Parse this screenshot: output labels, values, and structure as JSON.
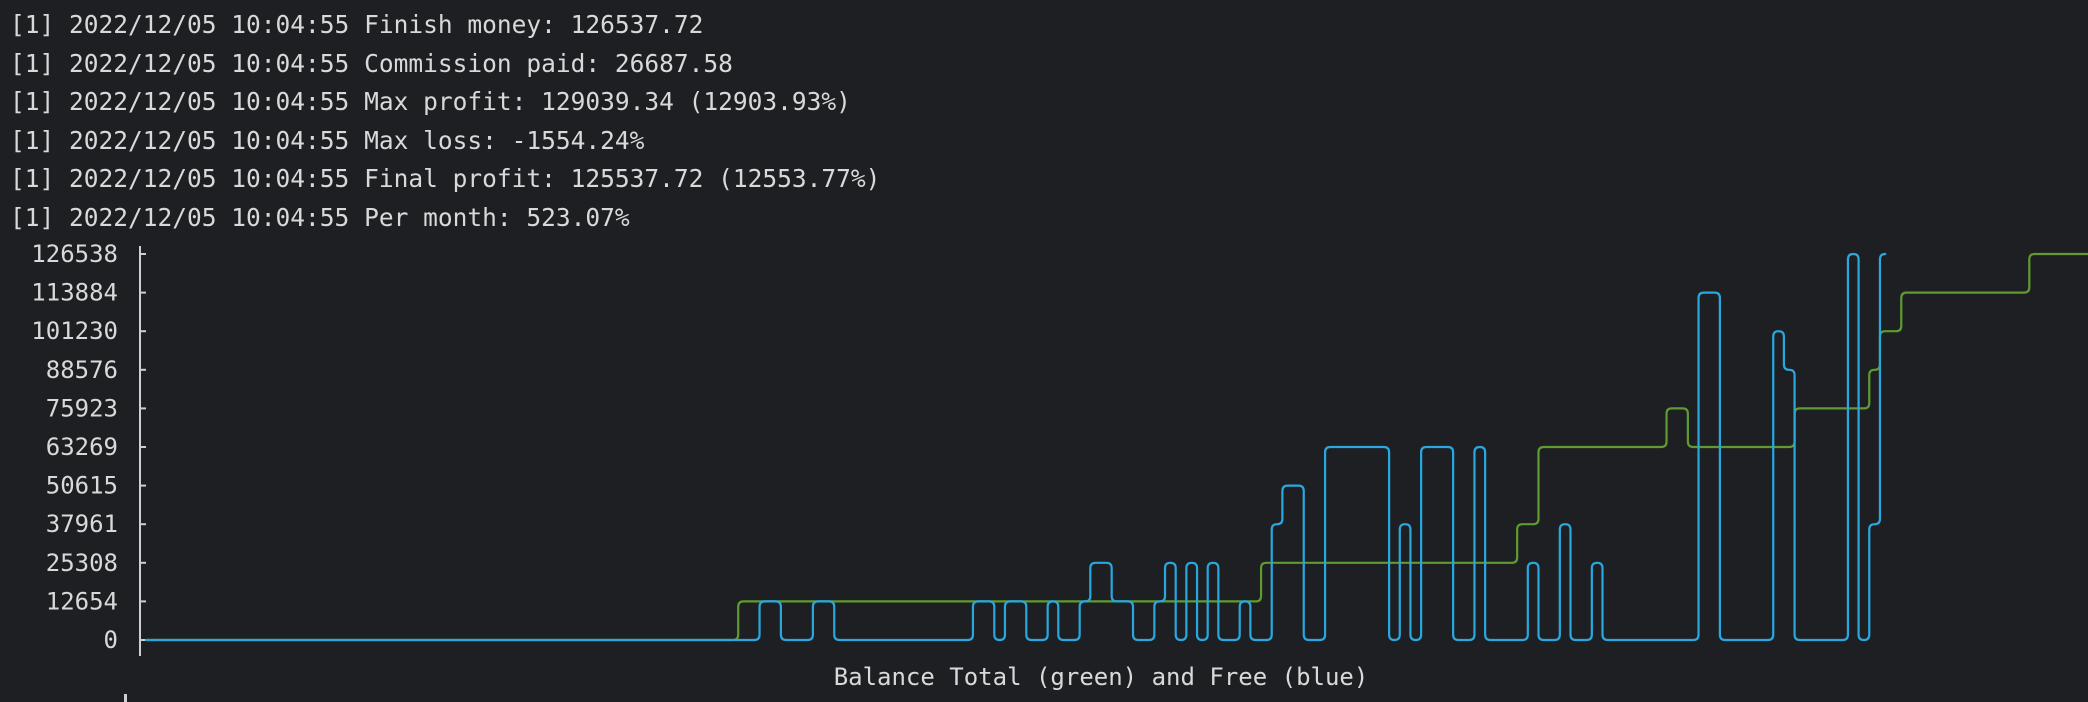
{
  "terminal": {
    "log_lines": [
      {
        "tag": "[1]",
        "timestamp": "2022/12/05 10:04:55",
        "message": "Finish money: 126537.72"
      },
      {
        "tag": "[1]",
        "timestamp": "2022/12/05 10:04:55",
        "message": "Commission paid: 26687.58"
      },
      {
        "tag": "[1]",
        "timestamp": "2022/12/05 10:04:55",
        "message": "Max profit: 129039.34 (12903.93%)"
      },
      {
        "tag": "[1]",
        "timestamp": "2022/12/05 10:04:55",
        "message": "Max loss: -1554.24%"
      },
      {
        "tag": "[1]",
        "timestamp": "2022/12/05 10:04:55",
        "message": "Final profit: 125537.72 (12553.77%)"
      },
      {
        "tag": "[1]",
        "timestamp": "2022/12/05 10:04:55",
        "message": "Per month: 523.07%"
      }
    ],
    "colors": {
      "background": "#1e1f22",
      "text": "#d9d9d9",
      "total_line": "#5f9b2f",
      "free_line": "#29a8e0",
      "axis": "#cfcfcf"
    }
  },
  "chart_data": {
    "type": "line",
    "title": "Balance Total (green) and Free (blue)",
    "xlabel": "",
    "ylabel": "",
    "ylim": [
      0,
      126538
    ],
    "y_ticks": [
      126538,
      113884,
      101230,
      88576,
      75923,
      63269,
      50615,
      37961,
      25308,
      12654,
      0
    ],
    "x": [
      1,
      2,
      3,
      4,
      5,
      6,
      7,
      8,
      9,
      10,
      11,
      12,
      13,
      14,
      15,
      16,
      17,
      18,
      19,
      20,
      21,
      22,
      23,
      24,
      25,
      26,
      27,
      28,
      29,
      30,
      31,
      32,
      33,
      34,
      35,
      36,
      37,
      38,
      39,
      40,
      41,
      42,
      43,
      44,
      45,
      46,
      47,
      48,
      49,
      50,
      51,
      52,
      53,
      54,
      55,
      56,
      57,
      58,
      59,
      60,
      61,
      62,
      63,
      64,
      65,
      66,
      67,
      68,
      69,
      70,
      71,
      72,
      73,
      74,
      75,
      76,
      77,
      78,
      79,
      80,
      81,
      82,
      83,
      84,
      85,
      86,
      87,
      88,
      89,
      90,
      91,
      92,
      93,
      94,
      95,
      96,
      97,
      98,
      99,
      100,
      101,
      102,
      103,
      104,
      105,
      106,
      107,
      108,
      109,
      110,
      111,
      112,
      113,
      114,
      115,
      116,
      117,
      118,
      119,
      120,
      121,
      122,
      123,
      124,
      125,
      126,
      127,
      128,
      129,
      130,
      131,
      132,
      133,
      134,
      135,
      136,
      137,
      138,
      139,
      140,
      141,
      142,
      143,
      144,
      145,
      146,
      147,
      148,
      149,
      150,
      151,
      152,
      153,
      154,
      155,
      156,
      157,
      158,
      159,
      160,
      161,
      162,
      163,
      164,
      165,
      166,
      167,
      168,
      169,
      170,
      171,
      172,
      173,
      174,
      175,
      176,
      177,
      178,
      179,
      180
    ],
    "series": [
      {
        "name": "Total",
        "color": "#5f9b2f",
        "values": [
          0,
          0,
          0,
          0,
          0,
          0,
          0,
          0,
          0,
          0,
          0,
          0,
          0,
          0,
          0,
          0,
          0,
          0,
          0,
          0,
          0,
          0,
          0,
          0,
          0,
          0,
          0,
          0,
          0,
          0,
          0,
          0,
          0,
          0,
          0,
          0,
          0,
          0,
          0,
          0,
          0,
          0,
          0,
          0,
          0,
          0,
          0,
          0,
          0,
          0,
          0,
          0,
          0,
          0,
          0,
          0,
          12654,
          12654,
          12654,
          12654,
          12654,
          12654,
          12654,
          12654,
          12654,
          12654,
          12654,
          12654,
          12654,
          12654,
          12654,
          12654,
          12654,
          12654,
          12654,
          12654,
          12654,
          12654,
          12654,
          12654,
          12654,
          12654,
          12654,
          12654,
          12654,
          12654,
          12654,
          12654,
          12654,
          12654,
          12654,
          12654,
          12654,
          12654,
          12654,
          12654,
          12654,
          12654,
          12654,
          12654,
          12654,
          12654,
          12654,
          12654,
          12654,
          25308,
          25308,
          25308,
          25308,
          25308,
          25308,
          25308,
          25308,
          25308,
          25308,
          25308,
          25308,
          25308,
          25308,
          25308,
          25308,
          25308,
          25308,
          25308,
          25308,
          25308,
          25308,
          25308,
          25308,
          37961,
          37961,
          63269,
          63269,
          63269,
          63269,
          63269,
          63269,
          63269,
          63269,
          63269,
          63269,
          63269,
          63269,
          75923,
          75923,
          63269,
          63269,
          63269,
          63269,
          63269,
          63269,
          63269,
          63269,
          63269,
          63269,
          75923,
          75923,
          75923,
          75923,
          75923,
          75923,
          75923,
          88576,
          101230,
          101230,
          113884,
          113884,
          113884,
          113884,
          113884,
          113884,
          113884,
          113884,
          113884,
          113884,
          113884,
          113884,
          126538,
          126538,
          126538,
          126538,
          126538,
          126538,
          126538
        ]
      },
      {
        "name": "Free",
        "color": "#29a8e0",
        "values": [
          0,
          0,
          0,
          0,
          0,
          0,
          0,
          0,
          0,
          0,
          0,
          0,
          0,
          0,
          0,
          0,
          0,
          0,
          0,
          0,
          0,
          0,
          0,
          0,
          0,
          0,
          0,
          0,
          0,
          0,
          0,
          0,
          0,
          0,
          0,
          0,
          0,
          0,
          0,
          0,
          0,
          0,
          0,
          0,
          0,
          0,
          0,
          0,
          0,
          0,
          0,
          0,
          0,
          0,
          0,
          0,
          0,
          0,
          12654,
          12654,
          0,
          0,
          0,
          12654,
          12654,
          0,
          0,
          0,
          0,
          0,
          0,
          0,
          0,
          0,
          0,
          0,
          0,
          0,
          12654,
          12654,
          0,
          12654,
          12654,
          0,
          0,
          12654,
          0,
          0,
          12654,
          25308,
          25308,
          12654,
          12654,
          0,
          0,
          12654,
          25308,
          0,
          25308,
          0,
          25308,
          0,
          0,
          12654,
          0,
          0,
          37961,
          50615,
          50615,
          0,
          0,
          63269,
          63269,
          63269,
          63269,
          63269,
          63269,
          0,
          37961,
          0,
          63269,
          63269,
          63269,
          0,
          0,
          63269,
          0,
          0,
          0,
          0,
          25308,
          0,
          0,
          37961,
          0,
          0,
          25308,
          0,
          0,
          0,
          0,
          0,
          0,
          0,
          0,
          0,
          113884,
          113884,
          0,
          0,
          0,
          0,
          0,
          101230,
          88576,
          0,
          0,
          0,
          0,
          0,
          126538,
          0,
          37961,
          126538
        ]
      }
    ],
    "grid": false,
    "legend": "none"
  }
}
